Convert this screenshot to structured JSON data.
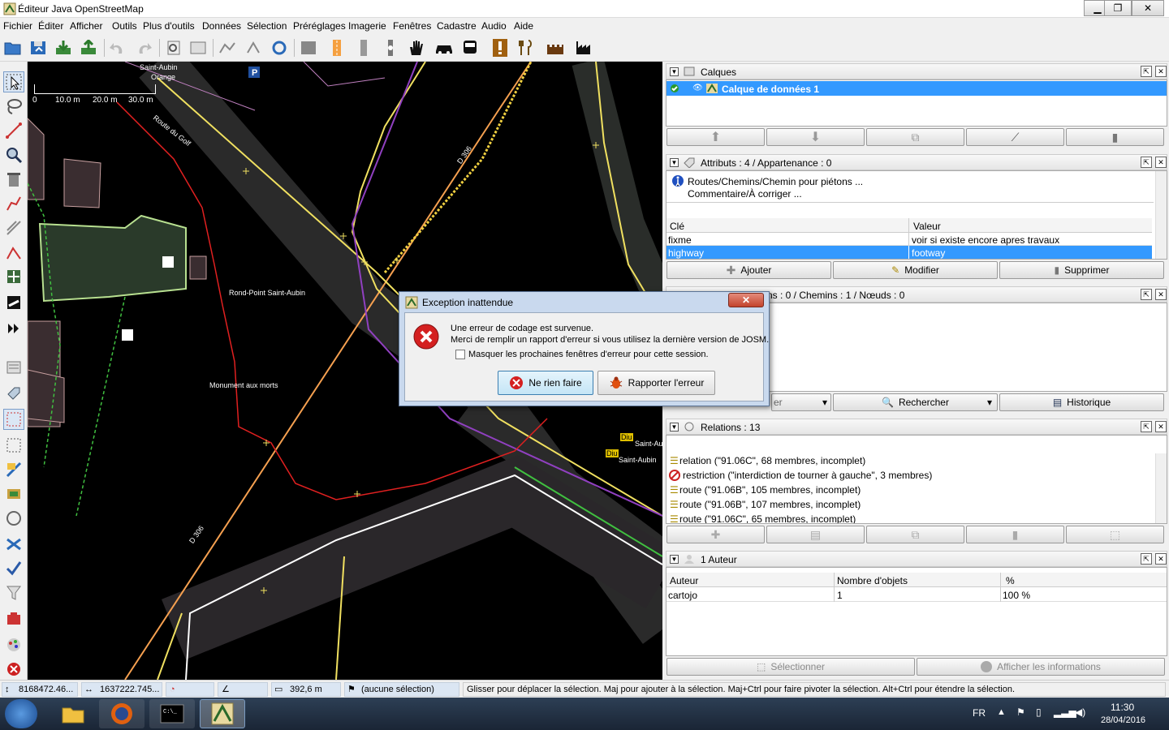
{
  "window": {
    "title": "Éditeur Java OpenStreetMap",
    "minimize": "▁",
    "maximize": "❐",
    "close": "✕"
  },
  "menu": [
    "Fichier",
    "Éditer",
    "Afficher",
    "Outils",
    "Plus d'outils",
    "Données",
    "Sélection",
    "Préréglages",
    "Imagerie",
    "Fenêtres",
    "Cadastre",
    "Audio",
    "Aide"
  ],
  "map": {
    "scale": {
      "t0": "0",
      "t1": "10.0 m",
      "t2": "20.0 m",
      "t3": "30.0 m"
    },
    "labels": {
      "saint_aubin": "Saint-Aubin",
      "orange": "Orange",
      "route_du_golf": "Route du Golf",
      "d306_a": "D 306",
      "d306_b": "D 306",
      "rond_point": "Rond-Point Saint-Aubin",
      "monument": "Monument aux morts",
      "saint_aubin2": "Saint-Au",
      "saint_aubin3": "Saint-Aubin",
      "diu1": "Diu",
      "diu2": "Diu",
      "parking": "P"
    }
  },
  "panels": {
    "layers": {
      "title": "Calques",
      "layer_name": "Calque de données 1"
    },
    "attributes": {
      "title": "Attributs : 4 / Appartenance : 0",
      "preset_line1": "Routes/Chemins/Chemin pour piétons ...",
      "preset_line2": "Commentaire/À corriger ...",
      "col_key": "Clé",
      "col_value": "Valeur",
      "rows": [
        {
          "key": "fixme",
          "value": "voir si existe encore apres travaux"
        },
        {
          "key": "highway",
          "value": "footway"
        }
      ],
      "btn_add": "Ajouter",
      "btn_edit": "Modifier",
      "btn_delete": "Supprimer"
    },
    "selection": {
      "title": "ns : 0 / Chemins : 1 / Nœuds : 0",
      "filter_label": "er",
      "btn_search": "Rechercher",
      "btn_history": "Historique"
    },
    "relations": {
      "title": "Relations : 13",
      "items": [
        "relation (\"91.06C\", 68 membres, incomplet)",
        "restriction (\"interdiction de tourner à gauche\", 3 membres)",
        "route (\"91.06B\", 105 membres, incomplet)",
        "route (\"91.06B\", 107 membres, incomplet)",
        "route (\"91.06C\", 65 membres, incomplet)"
      ]
    },
    "authors": {
      "title": "1 Auteur",
      "col_author": "Auteur",
      "col_count": "Nombre d'objets",
      "col_pct": "%",
      "rows": [
        {
          "author": "cartojo",
          "count": "1",
          "pct": "100 %"
        }
      ],
      "btn_select": "Sélectionner",
      "btn_info": "Afficher les informations"
    }
  },
  "dialog": {
    "title": "Exception inattendue",
    "line1": "Une erreur de codage est survenue.",
    "line2": "Merci de remplir un rapport d'erreur si vous utilisez la dernière version de JOSM.",
    "checkbox": "Masquer les prochaines fenêtres d'erreur pour cette session.",
    "btn_ignore": "Ne rien faire",
    "btn_report": "Rapporter l'erreur"
  },
  "status": {
    "lat": "8168472.46...",
    "lon": "1637222.745...",
    "distance": "392,6 m",
    "selection": "(aucune sélection)",
    "help": "Glisser pour déplacer la sélection. Maj pour ajouter à la sélection. Maj+Ctrl pour faire pivoter la sélection. Alt+Ctrl pour étendre la sélection."
  },
  "taskbar": {
    "lang": "FR",
    "time": "11:30",
    "date": "28/04/2016"
  },
  "colors": {
    "selection_blue": "#3399ff",
    "map_bg": "#000000",
    "way_red": "#e02020",
    "way_orange": "#f5a050",
    "way_yellow": "#f0e060",
    "error_red": "#cc2020"
  }
}
